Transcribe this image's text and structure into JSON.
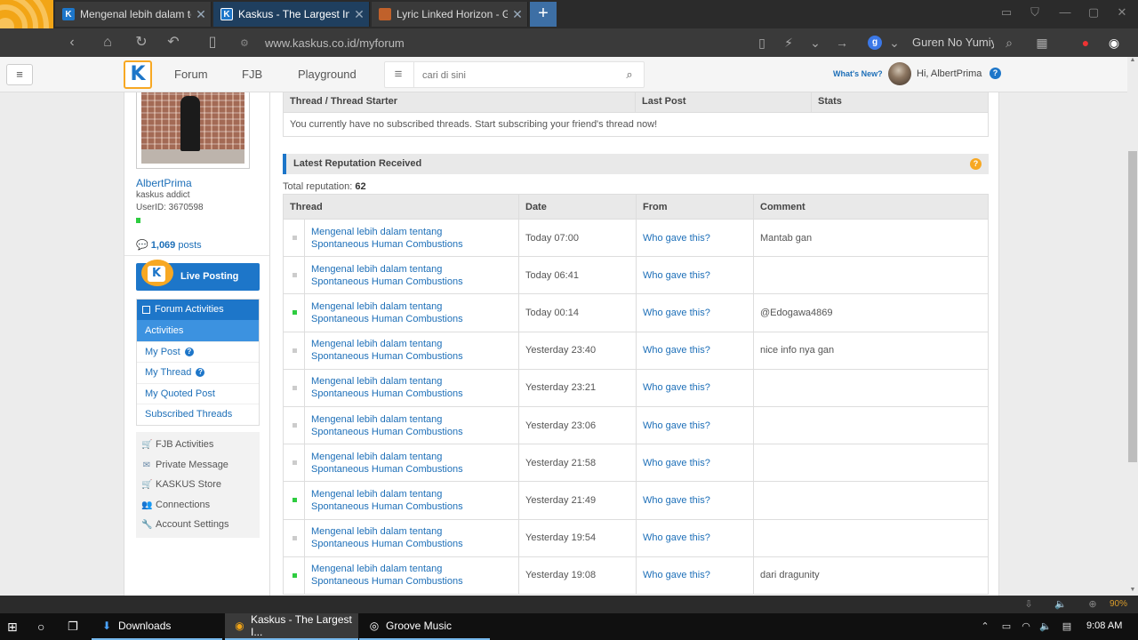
{
  "browser": {
    "tabs": [
      {
        "title": "Mengenal lebih dalam tentang Spontaneous",
        "favicon": "kaskus-icon",
        "active": false
      },
      {
        "title": "Kaskus - The Largest Indonesian Community",
        "favicon": "kaskus-icon",
        "active": true
      },
      {
        "title": "Lyric Linked Horizon - Guren No Yumiya",
        "favicon": "lyric-site-icon",
        "active": false
      }
    ],
    "new_tab_label": "+",
    "url": "www.kaskus.co.id/myforum",
    "search_engine_letter": "g",
    "search_text": "Guren No Yumiya",
    "zoom": "90%",
    "accent_color": "#f2a516"
  },
  "header": {
    "logo_letter": "K",
    "nav": [
      "Forum",
      "FJB",
      "Playground"
    ],
    "search_placeholder": "cari di sini",
    "whats_new": "What's New?",
    "greeting": "Hi, AlbertPrima",
    "help_symbol": "?"
  },
  "profile": {
    "username": "AlbertPrima",
    "title": "kaskus addict",
    "user_id": "UserID: 3670598",
    "posts_count": "1,069",
    "posts_label": "posts"
  },
  "sidebar": {
    "live_posting": "Live Posting",
    "forum_activities": "Forum Activities",
    "activity_items": [
      {
        "label": "Activities",
        "active": true,
        "help": false
      },
      {
        "label": "My Post",
        "active": false,
        "help": true
      },
      {
        "label": "My Thread",
        "active": false,
        "help": true
      },
      {
        "label": "My Quoted Post",
        "active": false,
        "help": false
      },
      {
        "label": "Subscribed Threads",
        "active": false,
        "help": false
      }
    ],
    "other_links": [
      {
        "label": "FJB Activities",
        "icon": "cart-icon"
      },
      {
        "label": "Private Message",
        "icon": "envelope-icon"
      },
      {
        "label": "KASKUS Store",
        "icon": "cart-icon"
      },
      {
        "label": "Connections",
        "icon": "people-icon"
      },
      {
        "label": "Account Settings",
        "icon": "wrench-icon"
      }
    ]
  },
  "subscribed": {
    "headers": [
      "Thread / Thread Starter",
      "Last Post",
      "Stats"
    ],
    "empty_message": "You currently have no subscribed threads. Start subscribing your friend's thread now!"
  },
  "reputation": {
    "title": "Latest Reputation Received",
    "total_label": "Total reputation:",
    "total_value": "62",
    "headers": [
      "Thread",
      "Date",
      "From",
      "Comment"
    ],
    "rows": [
      {
        "status": "grey",
        "thread": "Mengenal lebih dalam tentang Spontaneous Human Combustions",
        "date": "Today 07:00",
        "from": "Who gave this?",
        "comment": "Mantab gan"
      },
      {
        "status": "grey",
        "thread": "Mengenal lebih dalam tentang Spontaneous Human Combustions",
        "date": "Today 06:41",
        "from": "Who gave this?",
        "comment": ""
      },
      {
        "status": "green",
        "thread": "Mengenal lebih dalam tentang Spontaneous Human Combustions",
        "date": "Today 00:14",
        "from": "Who gave this?",
        "comment": "@Edogawa4869"
      },
      {
        "status": "grey",
        "thread": "Mengenal lebih dalam tentang Spontaneous Human Combustions",
        "date": "Yesterday 23:40",
        "from": "Who gave this?",
        "comment": "nice info nya gan"
      },
      {
        "status": "grey",
        "thread": "Mengenal lebih dalam tentang Spontaneous Human Combustions",
        "date": "Yesterday 23:21",
        "from": "Who gave this?",
        "comment": ""
      },
      {
        "status": "grey",
        "thread": "Mengenal lebih dalam tentang Spontaneous Human Combustions",
        "date": "Yesterday 23:06",
        "from": "Who gave this?",
        "comment": ""
      },
      {
        "status": "grey",
        "thread": "Mengenal lebih dalam tentang Spontaneous Human Combustions",
        "date": "Yesterday 21:58",
        "from": "Who gave this?",
        "comment": ""
      },
      {
        "status": "green",
        "thread": "Mengenal lebih dalam tentang Spontaneous Human Combustions",
        "date": "Yesterday 21:49",
        "from": "Who gave this?",
        "comment": ""
      },
      {
        "status": "grey",
        "thread": "Mengenal lebih dalam tentang Spontaneous Human Combustions",
        "date": "Yesterday 19:54",
        "from": "Who gave this?",
        "comment": ""
      },
      {
        "status": "green",
        "thread": "Mengenal lebih dalam tentang Spontaneous Human Combustions",
        "date": "Yesterday 19:08",
        "from": "Who gave this?",
        "comment": "dari dragunity"
      }
    ]
  },
  "taskbar": {
    "items": [
      {
        "label": "Downloads",
        "icon": "download-arrow-icon"
      },
      {
        "label": "Kaskus - The Largest I...",
        "icon": "browser-icon"
      },
      {
        "label": "Groove Music",
        "icon": "groove-music-icon"
      }
    ],
    "clock": "9:08 AM"
  }
}
